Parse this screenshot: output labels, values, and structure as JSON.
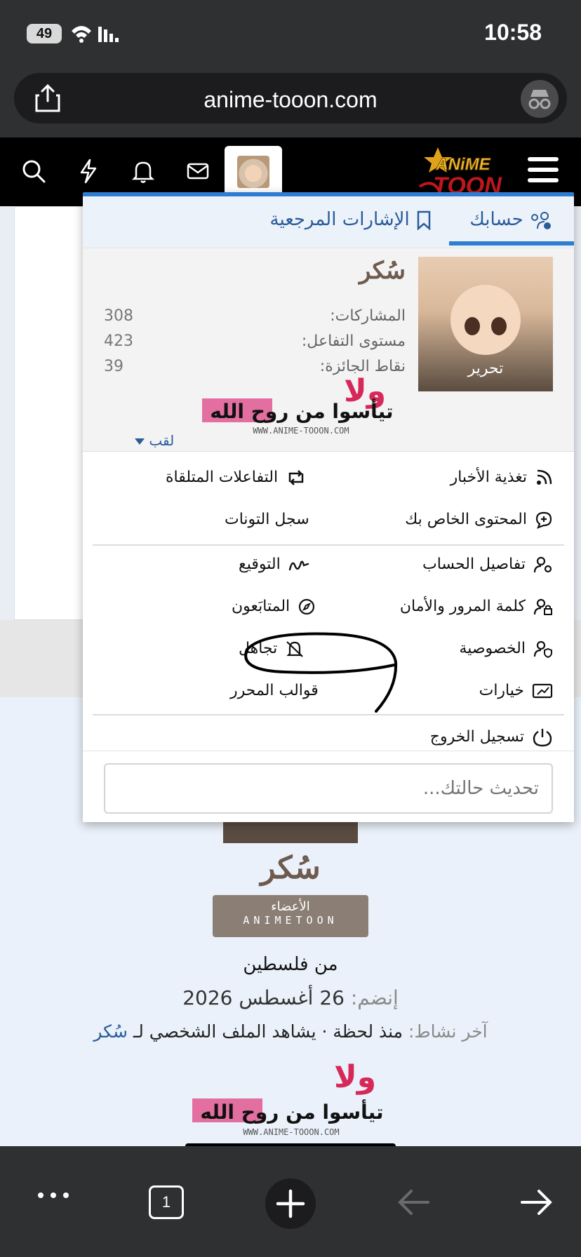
{
  "status_bar": {
    "battery": "49",
    "time": "10:58"
  },
  "browser": {
    "url": "anime-tooon.com"
  },
  "header": {
    "logo_alt": "ANIME TOON"
  },
  "menu": {
    "tabs": {
      "account": "حسابك",
      "bookmarks": "الإشارات المرجعية"
    },
    "profile": {
      "name": "سُكر",
      "edit_label": "تحرير",
      "stats": [
        {
          "label": "المشاركات:",
          "value": "308"
        },
        {
          "label": "مستوى التفاعل:",
          "value": "423"
        },
        {
          "label": "نقاط الجائزة:",
          "value": "39"
        }
      ],
      "title_link": "لقب"
    },
    "signature": {
      "line1": "ولا",
      "line2": "تيأسوا من روح الله",
      "url": "WWW.ANIME-TOOON.COM"
    },
    "links_right": {
      "news_feed": "تغذية الأخبار",
      "your_content": "المحتوى الخاص بك",
      "account_details": "تفاصيل الحساب",
      "password_security": "كلمة المرور والأمان",
      "privacy": "الخصوصية",
      "preferences": "خيارات",
      "logout": "تسجيل الخروج"
    },
    "links_left": {
      "reactions_received": "التفاعلات المتلقاة",
      "toon_log": "سجل التونات",
      "signature": "التوقيع",
      "following": "المتابَعون",
      "ignoring": "تجاهل",
      "editor_templates": "قوالب المحرر"
    },
    "status_placeholder": "تحديث حالتك..."
  },
  "page": {
    "profile_name": "سُكر",
    "badge": {
      "line1": "الأعضاء",
      "line2": "ANIMETOON"
    },
    "from": "من فلسطين",
    "joined_label": "إنضم:",
    "joined_value": "26 أغسطس 2026",
    "last_activity_label": "آخر نشاط:",
    "last_activity_value": "منذ لحظة · يشاهد الملف الشخصي لـ",
    "last_activity_link": "سُكر"
  },
  "toolbar": {
    "tabs_count": "1"
  }
}
